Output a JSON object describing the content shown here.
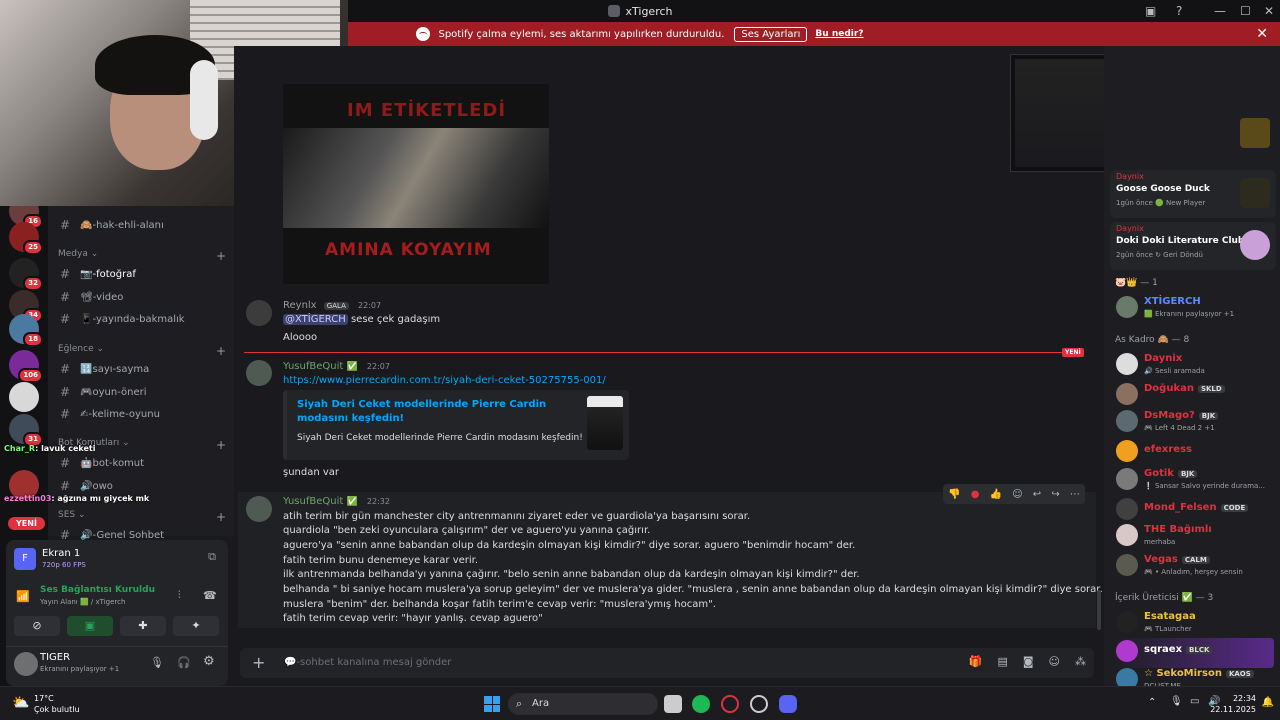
{
  "window": {
    "title": "xTigerch"
  },
  "banner": {
    "text": "Spotify çalma eylemi, ses aktarımı yapılırken durduruldu.",
    "button": "Ses Ayarları",
    "link": "Bu nedir?"
  },
  "servers": {
    "badges": [
      "16",
      "25",
      "32",
      "34",
      "18",
      "106",
      "31"
    ]
  },
  "channels": {
    "items": [
      {
        "label": "🙈-hak-ehli-alanı"
      },
      {
        "label": "📷-fotoğraf"
      },
      {
        "label": "📽-video"
      },
      {
        "label": "📱-yayında-bakmalık"
      },
      {
        "label": "🔢sayı-sayma"
      },
      {
        "label": "🎮oyun-öneri"
      },
      {
        "label": "✍-kelime-oyunu"
      },
      {
        "label": "🤖bot-komut"
      },
      {
        "label": "🔊owo"
      },
      {
        "label": "🔊-Genel Sohbet"
      }
    ],
    "categories": [
      "Medya",
      "Eğlence",
      "Bot Komutları",
      "SES"
    ]
  },
  "overlay_chat": [
    {
      "user": "Char_R",
      "text": ": lavuk ceketi"
    },
    {
      "user": "ezzettin03",
      "text": ": ağzına mı giycek mk"
    }
  ],
  "new_pill": "YENİ",
  "voice": {
    "screen_title": "Ekran 1",
    "screen_sub": "720p 60 FPS",
    "status": "Ses Bağlantısı Kuruldu",
    "status_sub": "Yayın Alanı 🟩 / xTigerch",
    "user": "TIGER",
    "user_sub": "Ekranını paylaşıyor +1"
  },
  "meme": {
    "top": "IM ETİKETLEDİ",
    "bottom": "AMINA KOYAYIM"
  },
  "messages": {
    "m1": {
      "user": "Reynlx",
      "tag": "GALA",
      "time": "22:07",
      "mention": "@XTİGERCH",
      "line1": "sese çek gadaşım",
      "line2": "Aloooo"
    },
    "m2": {
      "user": "YusufBeQuit",
      "time": "22:07",
      "url": "https://www.pierrecardin.com.tr/siyah-deri-ceket-50275755-001/",
      "embed_title": "Siyah Deri Ceket modellerinde Pierre Cardin modasını keşfedin!",
      "embed_desc": "Siyah Deri Ceket modellerinde Pierre Cardin modasını keşfedin!",
      "after": "şundan var"
    },
    "m3": {
      "user": "YusufBeQuit",
      "time": "22:32",
      "lines": [
        "atih terim bir gün manchester city antrenmanını ziyaret eder ve guardiola'ya başarısını sorar.",
        "quardiola \"ben zeki oyunculara çalışırım\" der ve aguero'yu yanına çağırır.",
        "aguero'ya \"senin anne babandan olup da kardeşin olmayan kişi kimdir?\" diye sorar. aguero \"benimdir hocam\" der.",
        "fatih terim bunu denemeye karar verir.",
        "ilk antrenmanda belhanda'yı yanına çağırır. \"belo senin anne babandan olup da kardeşin olmayan kişi kimdir?\" der.",
        "belhanda \" bi saniye hocam muslera'ya sorup geleyim\" der ve muslera'ya gider. \"muslera , senin anne babandan olup da kardeşin olmayan kişi kimdir?\" diye sorar.",
        "muslera \"benim\" der. belhanda koşar fatih terim'e cevap verir: \"muslera'ymış hocam\".",
        "fatih terim cevap verir: \"hayır yanlış. cevap aguero\""
      ]
    }
  },
  "new_marker": "YENİ",
  "composer": {
    "placeholder": "💬-sohbet kanalına mesaj gönder"
  },
  "members": {
    "activities": [
      {
        "user": "Daynix",
        "game": "Goose Goose Duck",
        "sub": "1gün önce  🟢 New Player"
      },
      {
        "user": "Daynix",
        "game": "Doki Doki Literature Club",
        "sub": "2gün önce  ↻ Geri Döndü"
      }
    ],
    "groups": [
      {
        "label": "🐷👑 — 1"
      },
      {
        "label": "As Kadro 🙈 — 8"
      },
      {
        "label": "İçerik Üreticisi ✅ — 3"
      }
    ],
    "list": [
      {
        "name": "XTİGERCH",
        "sub": "🟩 Ekranını paylaşıyor +1",
        "color": "#5b8cff"
      },
      {
        "name": "Daynix",
        "sub": "🔊 Sesli aramada",
        "color": "#e0313f"
      },
      {
        "name": "Doğukan",
        "tag": "SKLD",
        "sub": "",
        "color": "#e0313f"
      },
      {
        "name": "DsMago?",
        "tag": "BJK",
        "sub": "🎮 Left 4 Dead 2 +1",
        "color": "#e0313f"
      },
      {
        "name": "efexress",
        "sub": "",
        "color": "#e0313f"
      },
      {
        "name": "Gotik",
        "tag": "BJK",
        "sub": "❕ Sansar Salvo yerinde durama...",
        "color": "#e0313f"
      },
      {
        "name": "Mond_Felsen",
        "tag": "CODE",
        "sub": "",
        "color": "#e0313f"
      },
      {
        "name": "THE Bağımlı",
        "sub": "merhaba",
        "color": "#e0313f"
      },
      {
        "name": "Vegas",
        "tag": "CALM",
        "sub": "🎮 • Anladım, herşey sensin",
        "color": "#e0313f"
      },
      {
        "name": "Esatagaa",
        "sub": "🎮 TLauncher",
        "color": "#f0c040"
      },
      {
        "name": "sqraex",
        "tag": "BLCK",
        "sub": "",
        "color": "#ffffff"
      },
      {
        "name": "☆ SekoMirson",
        "tag": "KAOS",
        "sub": "DCLIST.ME",
        "color": "#f0c040"
      }
    ]
  },
  "taskbar": {
    "weather_temp": "17°C",
    "weather_desc": "Çok bulutlu",
    "search": "Ara",
    "time": "22:34",
    "date": "22.11.2025"
  }
}
